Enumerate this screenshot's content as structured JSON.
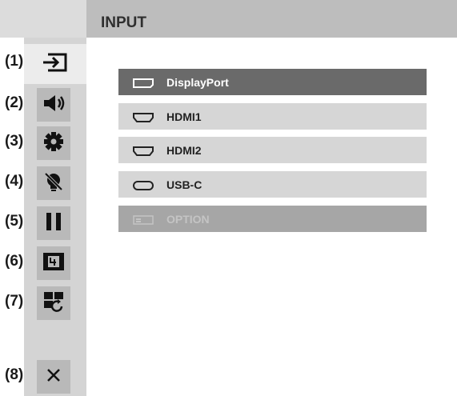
{
  "header": {
    "title": "INPUT"
  },
  "callouts": [
    "(1)",
    "(2)",
    "(3)",
    "(4)",
    "(5)",
    "(6)",
    "(7)",
    "(8)"
  ],
  "sidebar": {
    "items": [
      {
        "icon": "input-icon"
      },
      {
        "icon": "speaker-icon"
      },
      {
        "icon": "gear-icon"
      },
      {
        "icon": "brightness-off-icon"
      },
      {
        "icon": "pause-icon"
      },
      {
        "icon": "zoom-fit-icon"
      },
      {
        "icon": "layout-rotate-icon"
      },
      {
        "icon": "close-icon"
      }
    ]
  },
  "menu": {
    "items": [
      {
        "label": "DisplayPort",
        "icon": "displayport-icon",
        "state": "selected"
      },
      {
        "label": "HDMI1",
        "icon": "hdmi-icon",
        "state": "normal"
      },
      {
        "label": "HDMI2",
        "icon": "hdmi-icon",
        "state": "normal"
      },
      {
        "label": "USB-C",
        "icon": "usb-c-icon",
        "state": "normal"
      },
      {
        "label": "OPTION",
        "icon": "option-slot-icon",
        "state": "disabled"
      }
    ]
  },
  "colors": {
    "header": "#bdbdbd",
    "sidebar": "#d4d4d4",
    "selected_row": "#6a6a6a",
    "row": "#d6d6d6",
    "disabled_row": "#a6a6a6"
  }
}
